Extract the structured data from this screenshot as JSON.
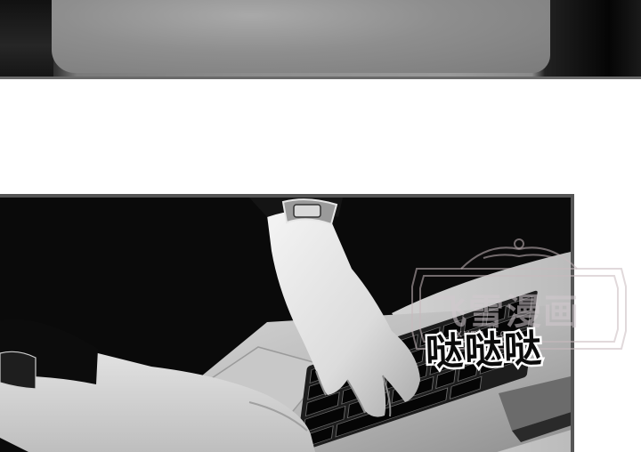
{
  "watermark": {
    "title": "飞雪漫画",
    "url": "xymh.com"
  },
  "sfx": {
    "text": "哒哒哒"
  },
  "colors": {
    "background": "#ffffff",
    "panel_border": "#555555",
    "ink": "#0b0b0b"
  }
}
